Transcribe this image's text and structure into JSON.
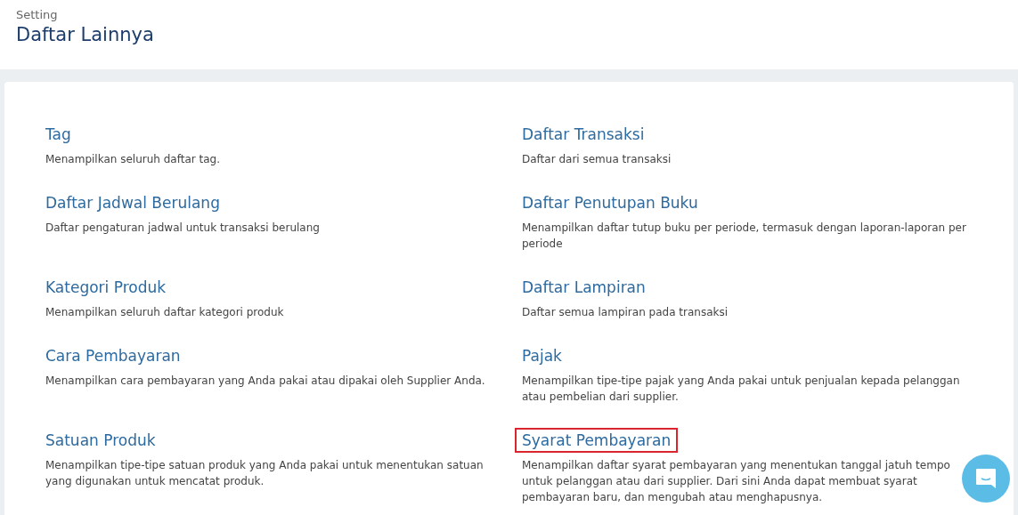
{
  "header": {
    "breadcrumb": "Setting",
    "title": "Daftar Lainnya"
  },
  "items": [
    {
      "title": "Tag",
      "description": "Menampilkan seluruh daftar tag.",
      "highlighted": false
    },
    {
      "title": "Daftar Transaksi",
      "description": "Daftar dari semua transaksi",
      "highlighted": false
    },
    {
      "title": "Daftar Jadwal Berulang",
      "description": "Daftar pengaturan jadwal untuk transaksi berulang",
      "highlighted": false
    },
    {
      "title": "Daftar Penutupan Buku",
      "description": "Menampilkan daftar tutup buku per periode, termasuk dengan laporan-laporan per periode",
      "highlighted": false
    },
    {
      "title": "Kategori Produk",
      "description": "Menampilkan seluruh daftar kategori produk",
      "highlighted": false
    },
    {
      "title": "Daftar Lampiran",
      "description": "Daftar semua lampiran pada transaksi",
      "highlighted": false
    },
    {
      "title": "Cara Pembayaran",
      "description": "Menampilkan cara pembayaran yang Anda pakai atau dipakai oleh Supplier Anda.",
      "highlighted": false
    },
    {
      "title": "Pajak",
      "description": "Menampilkan tipe-tipe pajak yang Anda pakai untuk penjualan kepada pelanggan atau pembelian dari supplier.",
      "highlighted": false
    },
    {
      "title": "Satuan Produk",
      "description": "Menampilkan tipe-tipe satuan produk yang Anda pakai untuk menentukan satuan yang digunakan untuk mencatat produk.",
      "highlighted": false
    },
    {
      "title": "Syarat Pembayaran",
      "description": "Menampilkan daftar syarat pembayaran yang menentukan tanggal jatuh tempo untuk pelanggan atau dari supplier. Dari sini Anda dapat membuat syarat pembayaran baru, dan mengubah atau menghapusnya.",
      "highlighted": true
    }
  ]
}
